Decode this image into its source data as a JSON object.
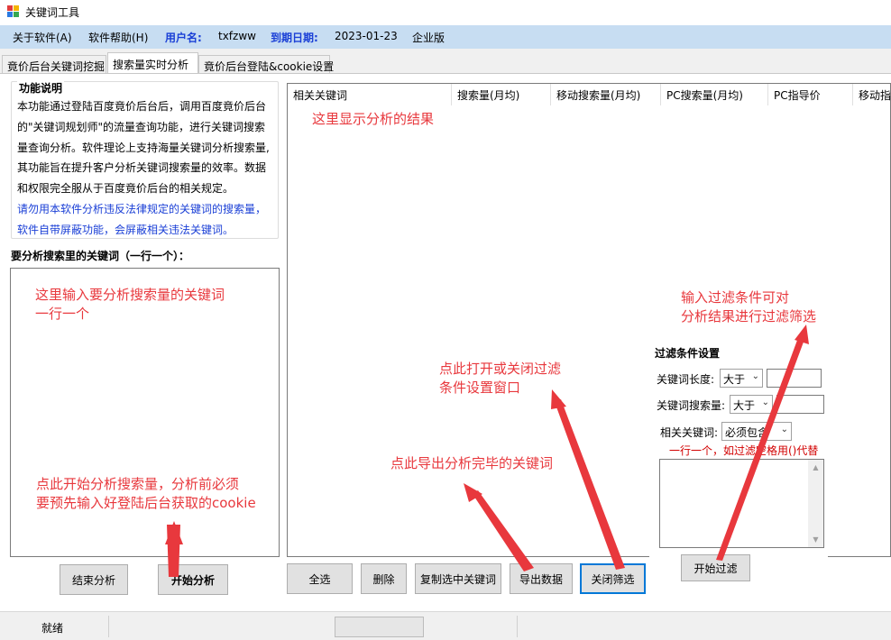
{
  "window": {
    "title": "关键词工具"
  },
  "menu": {
    "about": "关于软件(A)",
    "help": "软件帮助(H)",
    "user_label": "用户名:",
    "user_value": "txfzww",
    "expire_label": "到期日期:",
    "expire_value": "2023-01-23",
    "edition": "企业版"
  },
  "tabs": [
    "竟价后台关键词挖掘",
    "搜索量实时分析",
    "竟价后台登陆&cookie设置"
  ],
  "func": {
    "title": "功能说明",
    "lines": [
      "本功能通过登陆百度竟价后台后，调用百度竟价后台",
      "的\"关键词规划师\"的流量查询功能，进行关键词搜索",
      "量查询分析。软件理论上支持海量关键词分析搜索量,",
      "其功能旨在提升客户分析关键词搜索量的效率。数据",
      "和权限完全服从于百度竟价后台的相关规定。"
    ],
    "blue_lines": [
      "请勿用本软件分析违反法律规定的关键词的搜索量，",
      "软件自带屏蔽功能，会屏蔽相关违法关键词。"
    ]
  },
  "keywords_label": "要分析搜索里的关键词（一行一个）：",
  "grid": {
    "columns": [
      "相关关键词",
      "搜索量(月均)",
      "移动搜索量(月均)",
      "PC搜索量(月均)",
      "PC指导价",
      "移动指"
    ]
  },
  "buttons": {
    "stop": "结束分析",
    "start": "开始分析",
    "select_all": "全选",
    "delete": "删除",
    "copy": "复制选中关键词",
    "export": "导出数据",
    "close_filter": "关闭筛选",
    "start_filter": "开始过滤"
  },
  "filter": {
    "title": "过滤条件设置",
    "len_label": "关键词长度:",
    "len_op": "大于",
    "len_value": "",
    "vol_label": "关键词搜索量:",
    "vol_op": "大于",
    "vol_value": "",
    "related_label": "相关关键词:",
    "related_op": "必须包含",
    "hint": "一行一个，如过滤空格用()代替"
  },
  "annotations": {
    "result": "这里显示分析的结果",
    "input_1": "这里输入要分析搜索量的关键词",
    "input_2": "一行一个",
    "start_1": "点此开始分析搜索量，分析前必须",
    "start_2": "要预先输入好登陆后台获取的cookie",
    "export": "点此导出分析完毕的关键词",
    "toggle_1": "点此打开或关闭过滤",
    "toggle_2": "条件设置窗口",
    "filter_1": "输入过滤条件可对",
    "filter_2": "分析结果进行过滤筛选"
  },
  "status": {
    "text": "就绪"
  },
  "colors": {
    "menubar": "#c7ddf2",
    "accent_blue": "#1a3fd6",
    "annotation_red": "#e8383d",
    "hint_red": "#d20000"
  }
}
